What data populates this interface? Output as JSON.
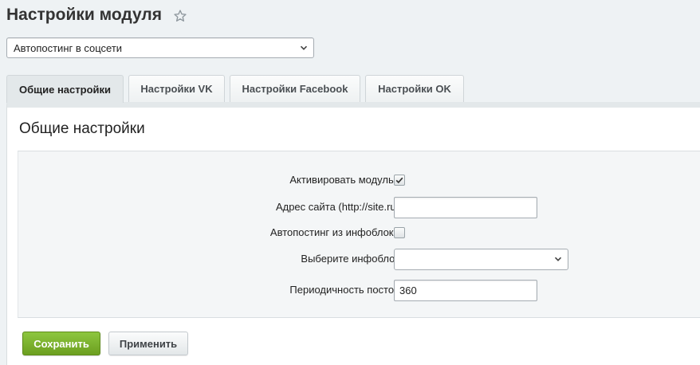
{
  "page": {
    "title": "Настройки модуля",
    "favorite_icon": "star-icon"
  },
  "module_select": {
    "value": "Автопостинг в соцсети",
    "icon": "chevron-down-icon"
  },
  "tabs": [
    {
      "label": "Общие настройки",
      "active": true
    },
    {
      "label": "Настройки VK",
      "active": false
    },
    {
      "label": "Настройки Facebook",
      "active": false
    },
    {
      "label": "Настройки OK",
      "active": false
    }
  ],
  "section": {
    "title": "Общие настройки"
  },
  "form": {
    "activate": {
      "label": "Активировать модуль?",
      "checked": true
    },
    "site_address": {
      "label": "Адрес сайта (http://site.ru)",
      "value": ""
    },
    "autopost_iblock": {
      "label": "Автопостинг из инфоблока",
      "checked": false
    },
    "iblock_select": {
      "label": "Выберите инфоблок",
      "value": ""
    },
    "post_period": {
      "label": "Периодичность постов",
      "value": "360"
    }
  },
  "buttons": {
    "save": "Сохранить",
    "apply": "Применить"
  },
  "colors": {
    "save_button": "#7cb32f",
    "page_background": "#eef2f4"
  }
}
